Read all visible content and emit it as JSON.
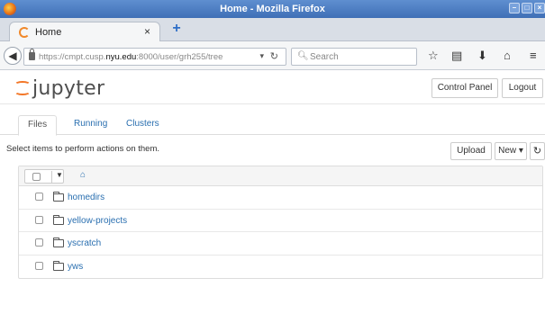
{
  "window": {
    "title": "Home - Mozilla Firefox"
  },
  "browser": {
    "tab_label": "Home",
    "tab_close": "×",
    "new_tab": "+",
    "url_plain_prefix": "https://cmpt.cusp.",
    "url_host": "nyu.edu",
    "url_plain_suffix": ":8000/user/grh255/tree",
    "search_placeholder": "Search"
  },
  "header": {
    "logo_text": "jupyter",
    "control_panel_label": "Control Panel",
    "logout_label": "Logout"
  },
  "tabs": [
    {
      "label": "Files",
      "active": true
    },
    {
      "label": "Running",
      "active": false
    },
    {
      "label": "Clusters",
      "active": false
    }
  ],
  "toolbar": {
    "hint": "Select items to perform actions on them.",
    "upload_label": "Upload",
    "new_label": "New ▾"
  },
  "files": [
    {
      "name": "homedirs",
      "type": "folder"
    },
    {
      "name": "yellow-projects",
      "type": "folder"
    },
    {
      "name": "yscratch",
      "type": "folder"
    },
    {
      "name": "yws",
      "type": "folder"
    }
  ],
  "colors": {
    "accent": "#f37626",
    "link": "#2a6fb0"
  }
}
